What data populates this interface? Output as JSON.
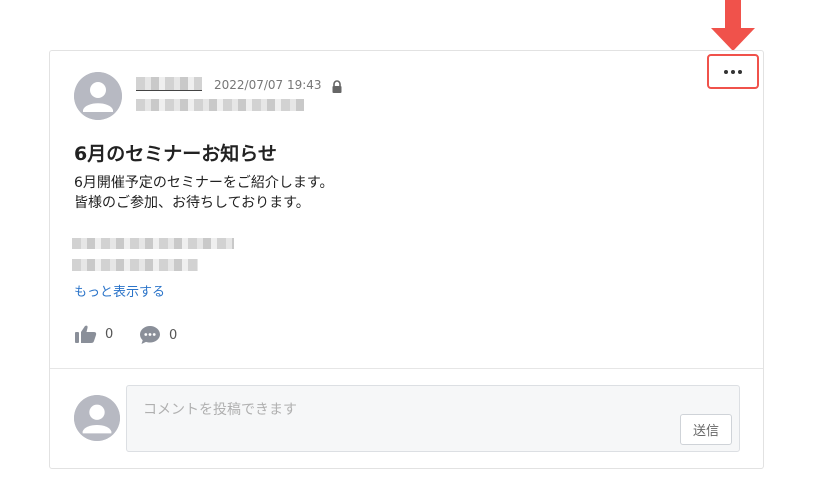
{
  "post": {
    "timestamp": "2022/07/07 19:43",
    "title": "6月のセミナーお知らせ",
    "body_lines": [
      "6月開催予定のセミナーをご紹介します。",
      "皆様のご参加、お待ちしております。"
    ],
    "show_more": "もっと表示する",
    "like_count": "0",
    "comment_count": "0"
  },
  "comment_form": {
    "placeholder": "コメントを投稿できます",
    "send_label": "送信"
  },
  "icons": {
    "more": "more-horizontal-icon",
    "lock": "lock-icon",
    "like": "thumbs-up-icon",
    "comment": "comment-bubble-icon",
    "avatar": "user-avatar-icon",
    "annotation": "red-down-arrow-icon"
  },
  "colors": {
    "highlight": "#f0524b",
    "link": "#2b74c9",
    "avatar": "#b7b9c2"
  }
}
